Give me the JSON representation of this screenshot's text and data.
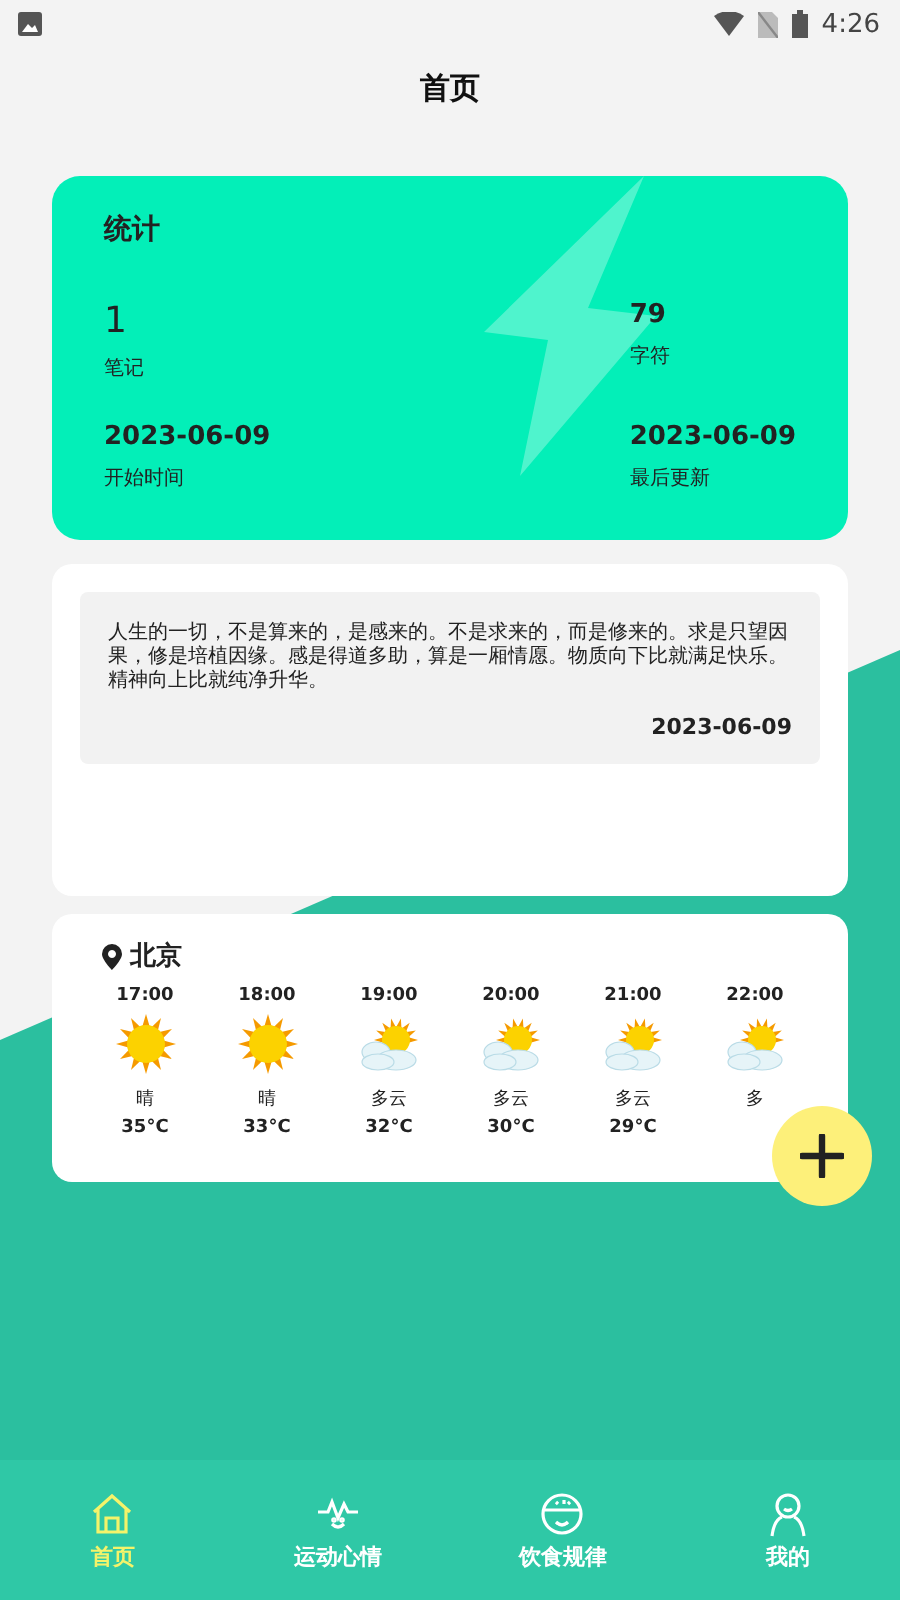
{
  "status_bar": {
    "time": "4:26"
  },
  "header": {
    "title": "首页"
  },
  "stats": {
    "title": "统计",
    "items": [
      {
        "value": "1",
        "label": "笔记"
      },
      {
        "value": "79",
        "label": "字符"
      },
      {
        "value": "2023-06-09",
        "label": "开始时间"
      },
      {
        "value": "2023-06-09",
        "label": "最后更新"
      }
    ]
  },
  "note": {
    "text": "人生的一切，不是算来的，是感来的。不是求来的，而是修来的。求是只望因果，修是培植因缘。感是得道多助，算是一厢情愿。物质向下比就满足快乐。精神向上比就纯净升华。",
    "date": "2023-06-09"
  },
  "weather": {
    "city": "北京",
    "hours": [
      {
        "time": "17:00",
        "kind": "sunny",
        "condition": "晴",
        "temp": "35°C"
      },
      {
        "time": "18:00",
        "kind": "sunny",
        "condition": "晴",
        "temp": "33°C"
      },
      {
        "time": "19:00",
        "kind": "cloudy",
        "condition": "多云",
        "temp": "32°C"
      },
      {
        "time": "20:00",
        "kind": "cloudy",
        "condition": "多云",
        "temp": "30°C"
      },
      {
        "time": "21:00",
        "kind": "cloudy",
        "condition": "多云",
        "temp": "29°C"
      },
      {
        "time": "22:00",
        "kind": "cloudy",
        "condition": "多"
      }
    ]
  },
  "nav": [
    {
      "label": "首页",
      "kind": "home",
      "selected": true
    },
    {
      "label": "运动心情",
      "kind": "pulse",
      "selected": false
    },
    {
      "label": "饮食规律",
      "kind": "bowl",
      "selected": false
    },
    {
      "label": "我的",
      "kind": "person",
      "selected": false
    }
  ]
}
